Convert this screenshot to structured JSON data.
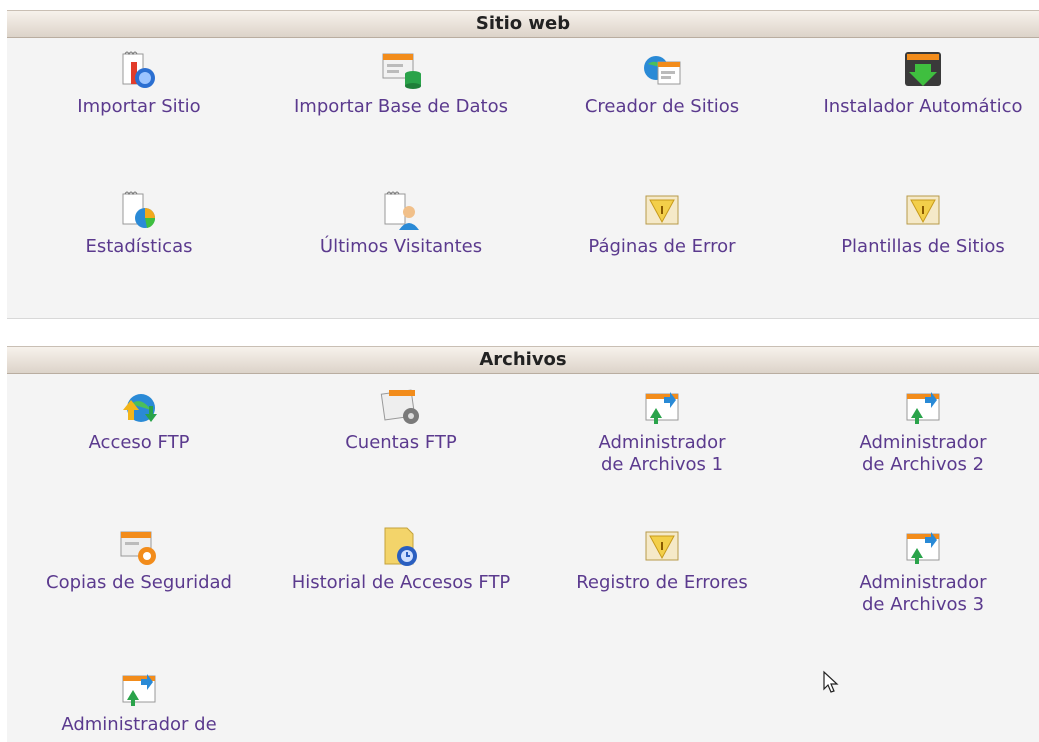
{
  "sections": {
    "web": {
      "title": "Sitio web",
      "items": [
        {
          "label": "Importar Sitio",
          "icon": "import-site-icon"
        },
        {
          "label": "Importar Base de Datos",
          "icon": "import-database-icon"
        },
        {
          "label": "Creador de Sitios",
          "icon": "site-builder-icon"
        },
        {
          "label": "Instalador Automático",
          "icon": "auto-installer-icon"
        },
        {
          "label": "Estadísticas",
          "icon": "statistics-icon"
        },
        {
          "label": "Últimos Visitantes",
          "icon": "latest-visitors-icon"
        },
        {
          "label": "Páginas de Error",
          "icon": "error-pages-icon"
        },
        {
          "label": "Plantillas de Sitios",
          "icon": "site-templates-icon"
        }
      ]
    },
    "files": {
      "title": "Archivos",
      "items": [
        {
          "label": "Acceso FTP",
          "icon": "ftp-access-icon"
        },
        {
          "label": "Cuentas FTP",
          "icon": "ftp-accounts-icon"
        },
        {
          "label": "Administrador de Archivos 1",
          "icon": "file-manager-icon"
        },
        {
          "label": "Administrador de Archivos 2",
          "icon": "file-manager-icon"
        },
        {
          "label": "Copias de Seguridad",
          "icon": "backup-icon"
        },
        {
          "label": "Historial de Accesos FTP",
          "icon": "ftp-history-icon"
        },
        {
          "label": "Registro de Errores",
          "icon": "error-log-icon"
        },
        {
          "label": "Administrador de Archivos 3",
          "icon": "file-manager-icon"
        },
        {
          "label": "Administrador de",
          "icon": "file-manager-icon"
        }
      ]
    }
  },
  "colors": {
    "link": "#5b3a8e",
    "header_bg": "#e6ded5"
  }
}
